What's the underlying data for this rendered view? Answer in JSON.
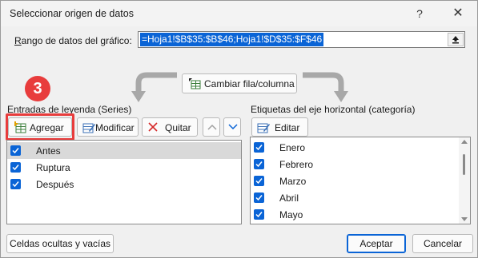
{
  "window": {
    "title": "Seleccionar origen de datos",
    "help_glyph": "?",
    "close_glyph": "✕"
  },
  "range": {
    "label": "Rango de datos del gráfico:",
    "value": "=Hoja1!$B$35:$B$46;Hoja1!$D$35:$F$46"
  },
  "switch_button": {
    "label": "Cambiar fila/columna"
  },
  "badge": {
    "number": "3"
  },
  "legend_entries": {
    "header": "Entradas de leyenda (Series)",
    "add_label": "Agregar",
    "edit_label": "Modificar",
    "remove_label": "Quitar",
    "items": [
      {
        "label": "Antes",
        "checked": true,
        "selected": true
      },
      {
        "label": "Ruptura",
        "checked": true,
        "selected": false
      },
      {
        "label": "Después",
        "checked": true,
        "selected": false
      }
    ]
  },
  "axis_labels": {
    "header": "Etiquetas del eje horizontal (categoría)",
    "edit_label": "Editar",
    "items": [
      {
        "label": "Enero",
        "checked": true
      },
      {
        "label": "Febrero",
        "checked": true
      },
      {
        "label": "Marzo",
        "checked": true
      },
      {
        "label": "Abril",
        "checked": true
      },
      {
        "label": "Mayo",
        "checked": true
      }
    ]
  },
  "footer": {
    "hidden_cells_label": "Celdas ocultas y vacías",
    "ok_label": "Aceptar",
    "cancel_label": "Cancelar"
  },
  "colors": {
    "accent": "#0a64d6",
    "badge": "#e83c3c",
    "highlight_border": "#e83c3c"
  }
}
